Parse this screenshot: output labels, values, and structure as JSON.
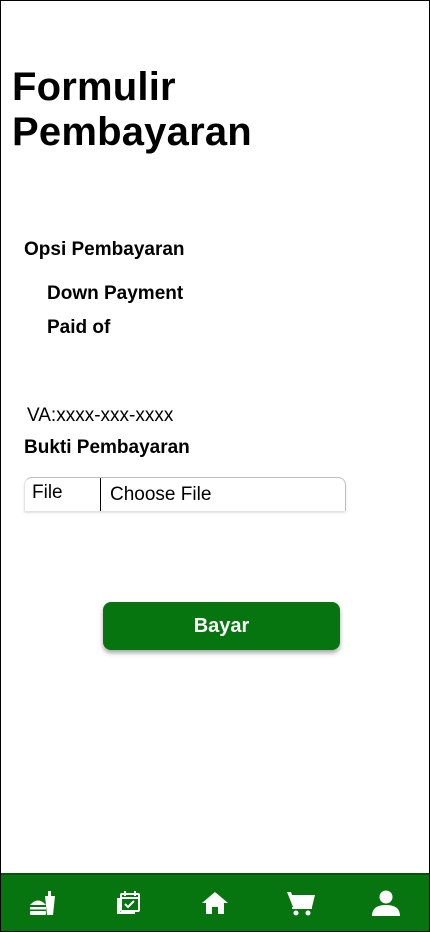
{
  "page": {
    "title": "Formulir Pembayaran"
  },
  "payment_options": {
    "label": "Opsi Pembayaran",
    "options": [
      "Down Payment",
      "Paid of"
    ]
  },
  "virtual_account": {
    "text": "VA:xxxx-xxx-xxxx"
  },
  "proof": {
    "label": "Bukti Pembayaran",
    "file_prefix": "File",
    "choose_label": "Choose File"
  },
  "actions": {
    "pay_label": "Bayar"
  },
  "bottom_nav": {
    "background": "#07750f",
    "items": [
      {
        "icon": "fastfood-icon"
      },
      {
        "icon": "calendar-check-icon"
      },
      {
        "icon": "home-icon"
      },
      {
        "icon": "cart-icon"
      },
      {
        "icon": "person-icon"
      }
    ]
  },
  "colors": {
    "accent": "#07750f",
    "text": "#000000",
    "background": "#ffffff"
  }
}
